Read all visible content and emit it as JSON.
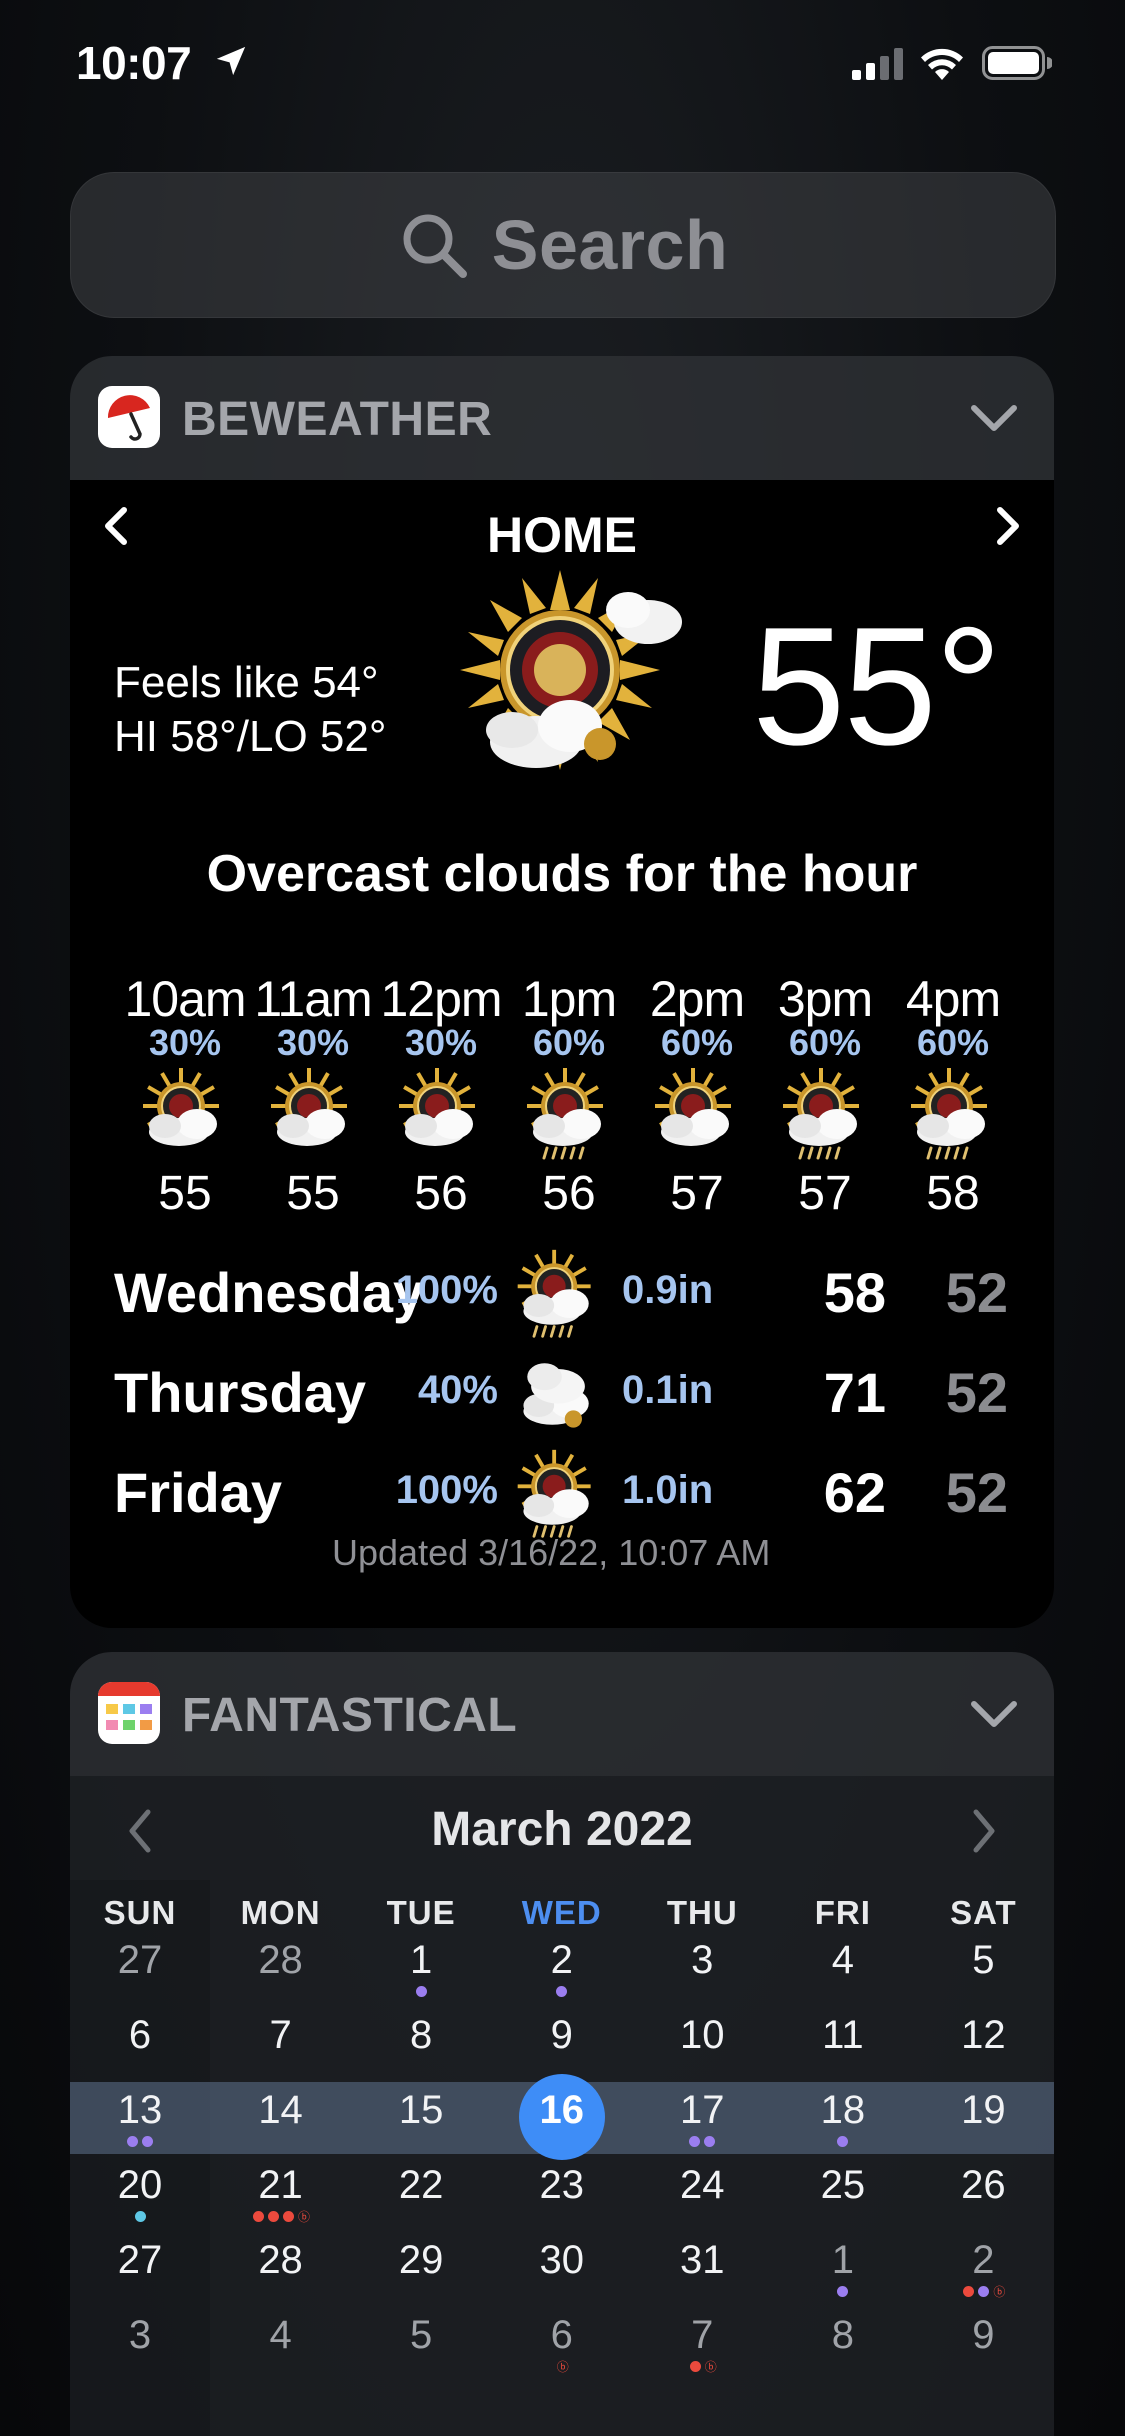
{
  "status_bar": {
    "time": "10:07"
  },
  "search": {
    "placeholder": "Search"
  },
  "beweather": {
    "app_name": "BEWEATHER",
    "location": "HOME",
    "feels_like": "Feels like 54°",
    "hi_lo": "HI 58°/LO 52°",
    "current_temp": "55°",
    "summary": "Overcast clouds for the hour",
    "hourly": [
      {
        "time": "10am",
        "precip": "30%",
        "temp": "55",
        "icon": "sun-cloud-icon"
      },
      {
        "time": "11am",
        "precip": "30%",
        "temp": "55",
        "icon": "sun-cloud-icon"
      },
      {
        "time": "12pm",
        "precip": "30%",
        "temp": "56",
        "icon": "sun-cloud-icon"
      },
      {
        "time": "1pm",
        "precip": "60%",
        "temp": "56",
        "icon": "rain-cloud-icon"
      },
      {
        "time": "2pm",
        "precip": "60%",
        "temp": "57",
        "icon": "sun-cloud-icon"
      },
      {
        "time": "3pm",
        "precip": "60%",
        "temp": "57",
        "icon": "rain-cloud-icon"
      },
      {
        "time": "4pm",
        "precip": "60%",
        "temp": "58",
        "icon": "rain-cloud-icon"
      }
    ],
    "daily": [
      {
        "day": "Wednesday",
        "precip": "100%",
        "amount": "0.9in",
        "hi": "58",
        "lo": "52",
        "icon": "rain-cloud-icon"
      },
      {
        "day": "Thursday",
        "precip": "40%",
        "amount": "0.1in",
        "hi": "71",
        "lo": "52",
        "icon": "cloud-icon"
      },
      {
        "day": "Friday",
        "precip": "100%",
        "amount": "1.0in",
        "hi": "62",
        "lo": "52",
        "icon": "rain-cloud-icon"
      }
    ],
    "updated": "Updated 3/16/22, 10:07 AM"
  },
  "fantastical": {
    "app_name": "FANTASTICAL",
    "month": "March 2022",
    "weekdays": [
      "SUN",
      "MON",
      "TUE",
      "WED",
      "THU",
      "FRI",
      "SAT"
    ],
    "today_weekday_index": 3,
    "weeks": [
      [
        {
          "d": "27",
          "dim": true
        },
        {
          "d": "28",
          "dim": true
        },
        {
          "d": "1",
          "dots": [
            "purple"
          ]
        },
        {
          "d": "2",
          "dots": [
            "purple"
          ]
        },
        {
          "d": "3"
        },
        {
          "d": "4"
        },
        {
          "d": "5"
        }
      ],
      [
        {
          "d": "6"
        },
        {
          "d": "7"
        },
        {
          "d": "8"
        },
        {
          "d": "9"
        },
        {
          "d": "10"
        },
        {
          "d": "11"
        },
        {
          "d": "12"
        }
      ],
      [
        {
          "d": "13",
          "dots": [
            "purple",
            "purple"
          ]
        },
        {
          "d": "14"
        },
        {
          "d": "15"
        },
        {
          "d": "16",
          "today": true
        },
        {
          "d": "17",
          "dots": [
            "purple",
            "purple"
          ]
        },
        {
          "d": "18",
          "dots": [
            "purple"
          ]
        },
        {
          "d": "19"
        }
      ],
      [
        {
          "d": "20",
          "dots": [
            "cyan"
          ]
        },
        {
          "d": "21",
          "dots": [
            "red",
            "red",
            "red"
          ],
          "mini": "ⓑ"
        },
        {
          "d": "22"
        },
        {
          "d": "23"
        },
        {
          "d": "24"
        },
        {
          "d": "25"
        },
        {
          "d": "26"
        }
      ],
      [
        {
          "d": "27"
        },
        {
          "d": "28"
        },
        {
          "d": "29"
        },
        {
          "d": "30"
        },
        {
          "d": "31"
        },
        {
          "d": "1",
          "dim": true,
          "dots": [
            "purple"
          ]
        },
        {
          "d": "2",
          "dim": true,
          "dots": [
            "red",
            "purple"
          ],
          "mini": "ⓑ"
        }
      ],
      [
        {
          "d": "3",
          "dim": true
        },
        {
          "d": "4",
          "dim": true
        },
        {
          "d": "5",
          "dim": true
        },
        {
          "d": "6",
          "dim": true,
          "mini": "ⓑ"
        },
        {
          "d": "7",
          "dim": true,
          "dots": [
            "red"
          ],
          "mini": "ⓑ"
        },
        {
          "d": "8",
          "dim": true
        },
        {
          "d": "9",
          "dim": true
        }
      ]
    ]
  }
}
